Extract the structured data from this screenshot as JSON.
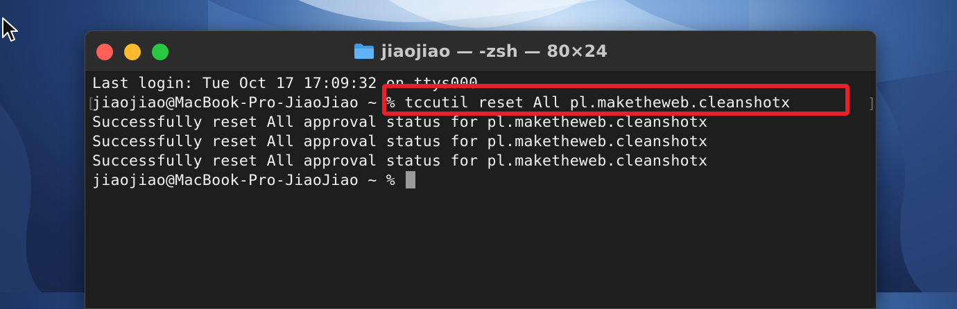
{
  "window": {
    "title": "jiaojiao — -zsh — 80×24"
  },
  "terminal": {
    "lines": [
      "Last login: Tue Oct 17 17:09:32 on ttys000",
      "jiaojiao@MacBook-Pro-JiaoJiao ~ % tccutil reset All pl.maketheweb.cleanshotx",
      "Successfully reset All approval status for pl.maketheweb.cleanshotx",
      "Successfully reset All approval status for pl.maketheweb.cleanshotx",
      "Successfully reset All approval status for pl.maketheweb.cleanshotx"
    ],
    "prompt": "jiaojiao@MacBook-Pro-JiaoJiao ~ % "
  },
  "colors": {
    "highlight": "#e8202a",
    "close": "#fe5f57",
    "minimize": "#febb2e",
    "maximize": "#28c840"
  },
  "icons": {
    "pointer": "mouse-pointer-icon",
    "folder": "folder-icon"
  }
}
